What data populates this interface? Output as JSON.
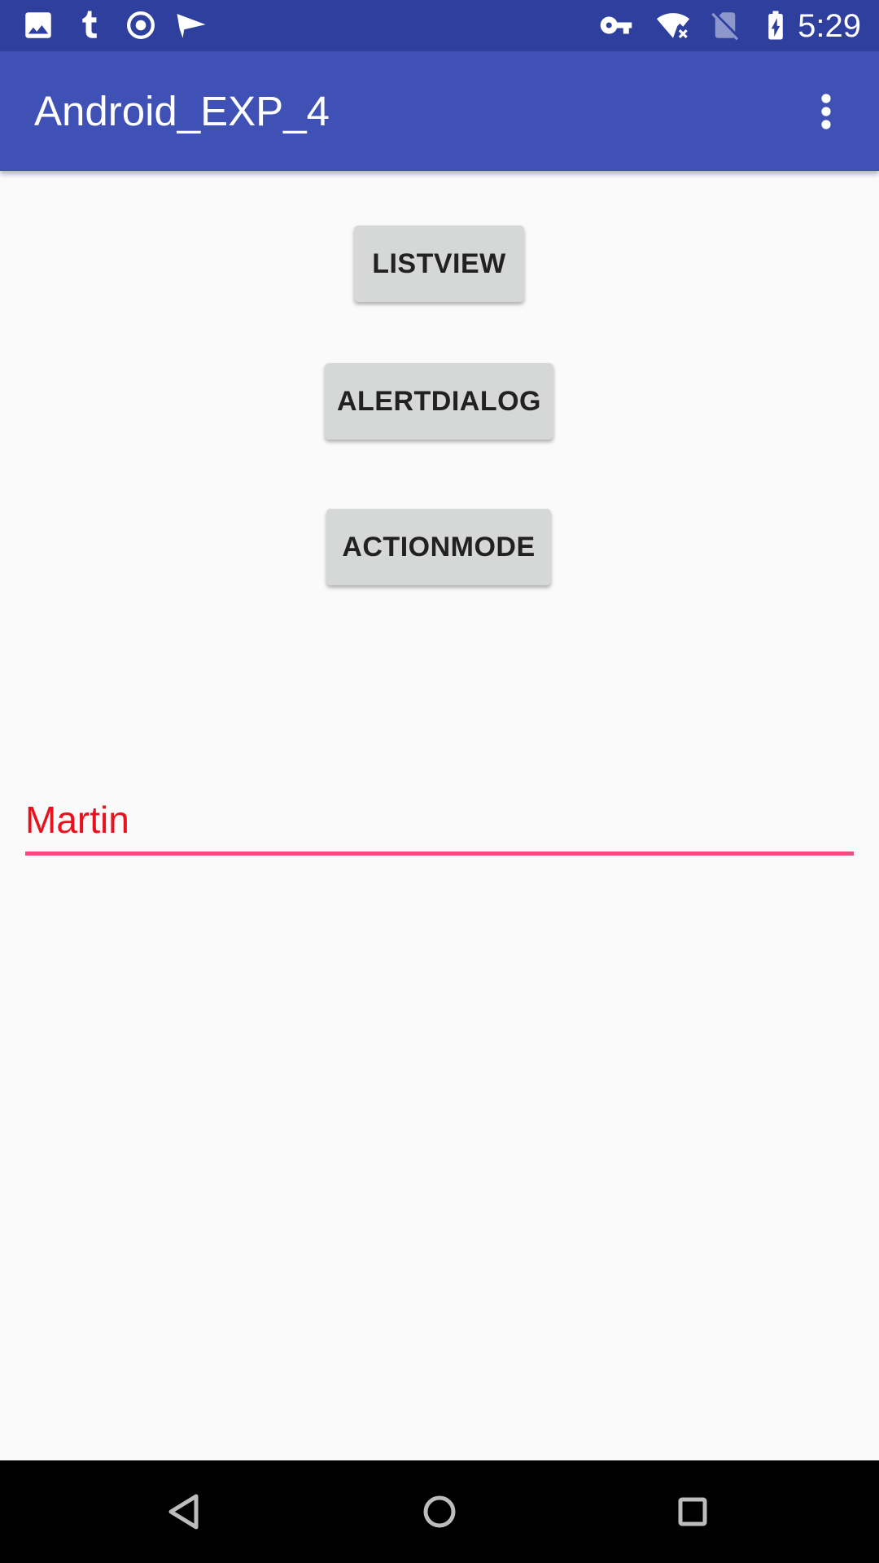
{
  "status_bar": {
    "time": "5:29",
    "left_icons": [
      "image-icon",
      "tumblr-icon",
      "target-icon",
      "send-icon"
    ],
    "right_icons": [
      "vpn-key-icon",
      "wifi-off-icon",
      "no-sim-icon",
      "battery-charging-icon"
    ],
    "color": "#2F3F9E"
  },
  "app_bar": {
    "title": "Android_EXP_4",
    "menu_icon": "more-vert-icon",
    "color": "#3F51B5"
  },
  "buttons": {
    "listview": "LISTVIEW",
    "alertdialog": "ALERTDIALOG",
    "actionmode": "ACTIONMODE"
  },
  "edit_text": {
    "value": "Martin",
    "text_color": "#E8121E",
    "underline_color": "#EF4D80"
  },
  "nav_bar": {
    "icons": [
      "back-icon",
      "home-icon",
      "recents-icon"
    ]
  }
}
